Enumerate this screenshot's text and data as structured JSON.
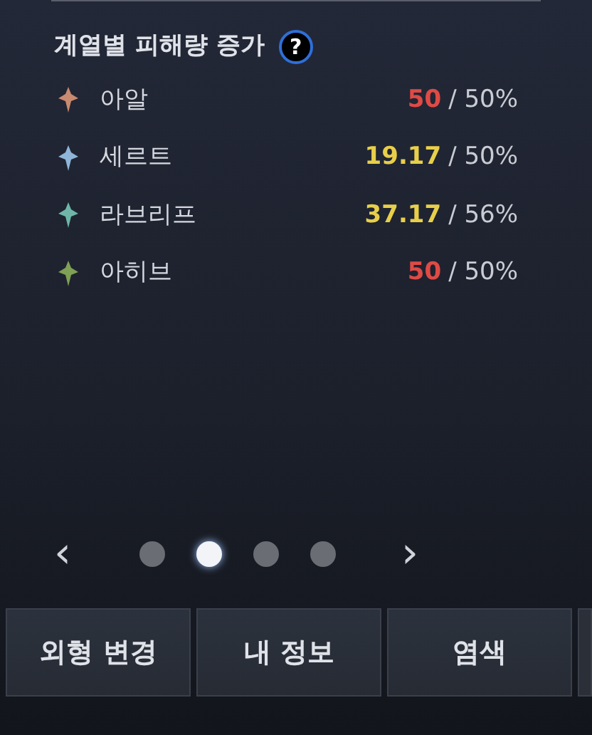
{
  "section": {
    "title": "계열별 피해량 증가",
    "help": "?"
  },
  "rows": [
    {
      "name": "아알",
      "value": "50",
      "max": "/ 50%",
      "color": "#e04a45",
      "icon": {
        "color": "#c98a70"
      }
    },
    {
      "name": "세르트",
      "value": "19.17",
      "max": "/ 50%",
      "color": "#e8cf4a",
      "icon": {
        "color": "#8fb6d8"
      }
    },
    {
      "name": "라브리프",
      "value": "37.17",
      "max": "/ 56%",
      "color": "#e8cf4a",
      "icon": {
        "color": "#6fb6a8"
      }
    },
    {
      "name": "아히브",
      "value": "50",
      "max": "/ 50%",
      "color": "#e04a45",
      "icon": {
        "color": "#7fa055"
      }
    }
  ],
  "pager": {
    "prev": "‹",
    "next": "›",
    "dots": [
      {
        "selected": false
      },
      {
        "selected": true
      },
      {
        "selected": false
      },
      {
        "selected": false
      }
    ]
  },
  "buttons": [
    "외형 변경",
    "내 정보",
    "염색"
  ]
}
